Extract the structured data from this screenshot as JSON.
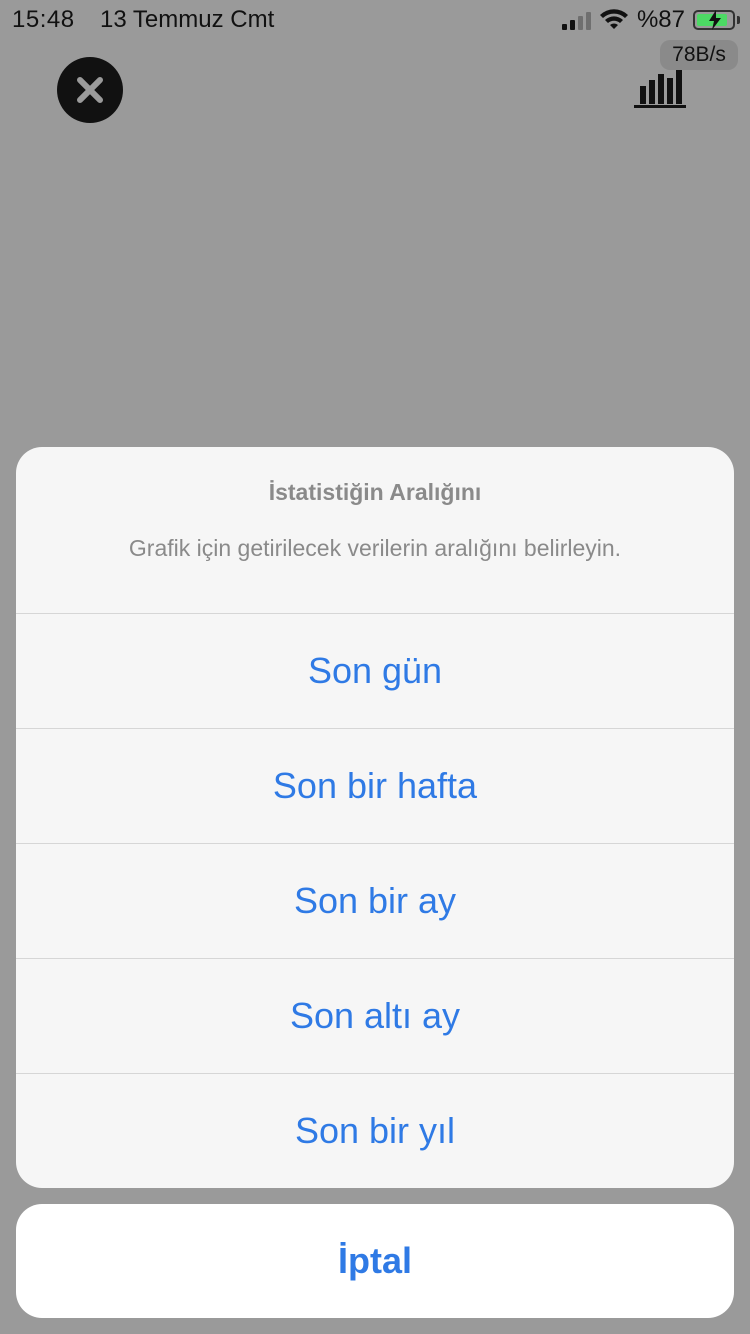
{
  "status_bar": {
    "time": "15:48",
    "date": "13 Temmuz Cmt",
    "battery_percent": "%87",
    "battery_level": 0.87,
    "signal_bars": 2,
    "signal_total": 4
  },
  "network": {
    "speed": "78B/s"
  },
  "toolbar": {
    "close_icon": "close-icon",
    "chart_icon": "bar-chart-icon"
  },
  "action_sheet": {
    "title": "İstatistiğin Aralığını",
    "message": "Grafik için getirilecek verilerin aralığını belirleyin.",
    "options": [
      {
        "label": "Son gün"
      },
      {
        "label": "Son bir hafta"
      },
      {
        "label": "Son bir ay"
      },
      {
        "label": "Son altı ay"
      },
      {
        "label": "Son bir yıl"
      }
    ],
    "cancel_label": "İptal"
  },
  "colors": {
    "accent": "#2f7ae5",
    "overlay": "#9a9a9a",
    "sheet": "#f6f6f6",
    "battery_fill": "#4cd964"
  }
}
